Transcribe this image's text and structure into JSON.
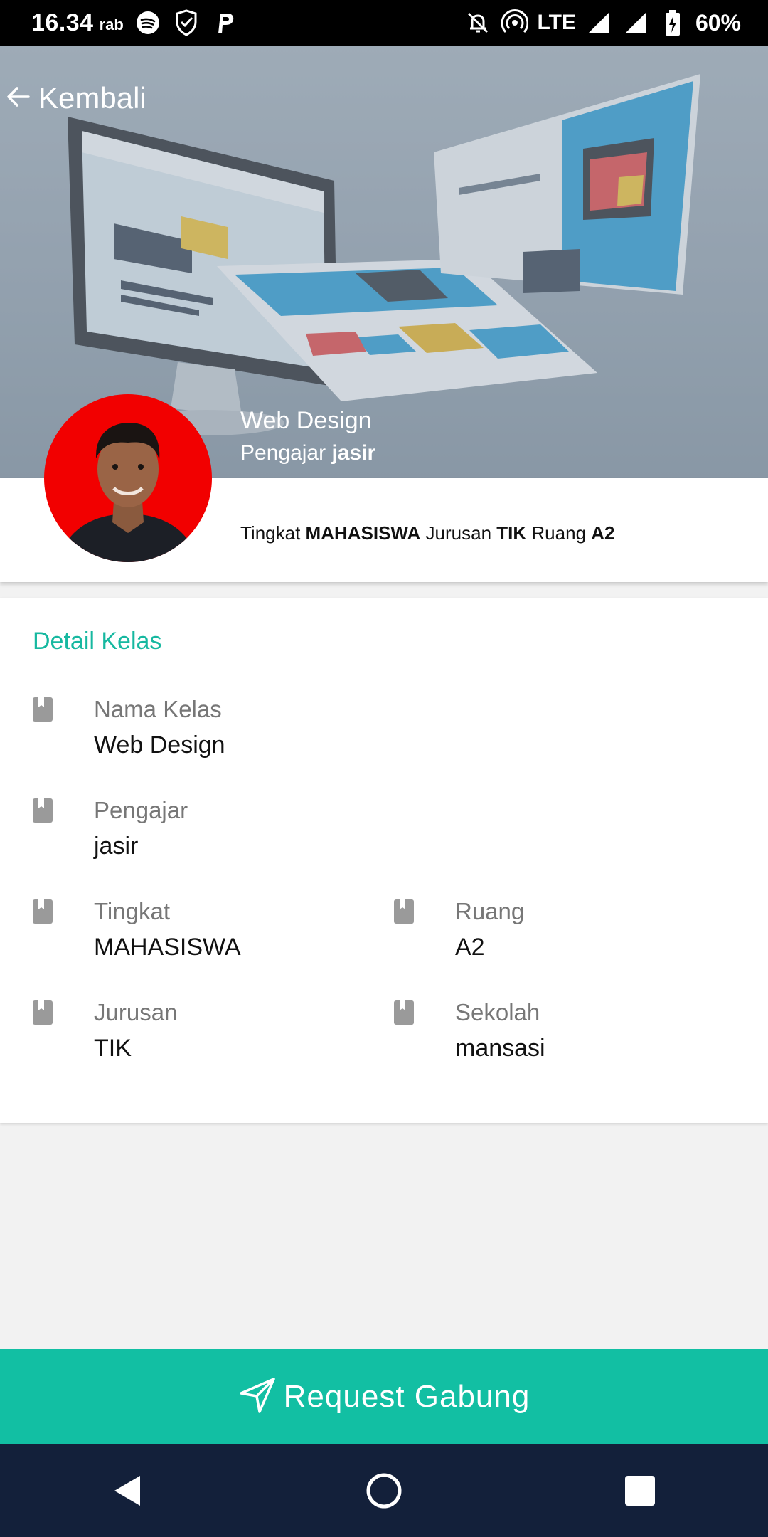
{
  "status_bar": {
    "time": "16.34",
    "day": "rab",
    "network": "LTE",
    "battery": "60%"
  },
  "header": {
    "back_label": "Kembali"
  },
  "class_info": {
    "title": "Web Design",
    "teacher_prefix": "Pengajar",
    "teacher_name": "jasir",
    "summary": {
      "tingkat_label": "Tingkat",
      "tingkat_value": "MAHASISWA",
      "jurusan_label": "Jurusan",
      "jurusan_value": "TIK",
      "ruang_label": "Ruang",
      "ruang_value": "A2"
    }
  },
  "detail": {
    "title": "Detail Kelas",
    "fields": [
      {
        "label": "Nama Kelas",
        "value": "Web Design"
      },
      {
        "label": "Pengajar",
        "value": "jasir"
      },
      {
        "label": "Tingkat",
        "value": "MAHASISWA"
      },
      {
        "label": "Ruang",
        "value": "A2"
      },
      {
        "label": "Jurusan",
        "value": "TIK"
      },
      {
        "label": "Sekolah",
        "value": "mansasi"
      }
    ]
  },
  "actions": {
    "request_label": "Request Gabung"
  },
  "colors": {
    "accent": "#12bfa3",
    "title_accent": "#16b8a0",
    "avatar_bg": "#f20000",
    "nav_bg": "#13203a"
  }
}
